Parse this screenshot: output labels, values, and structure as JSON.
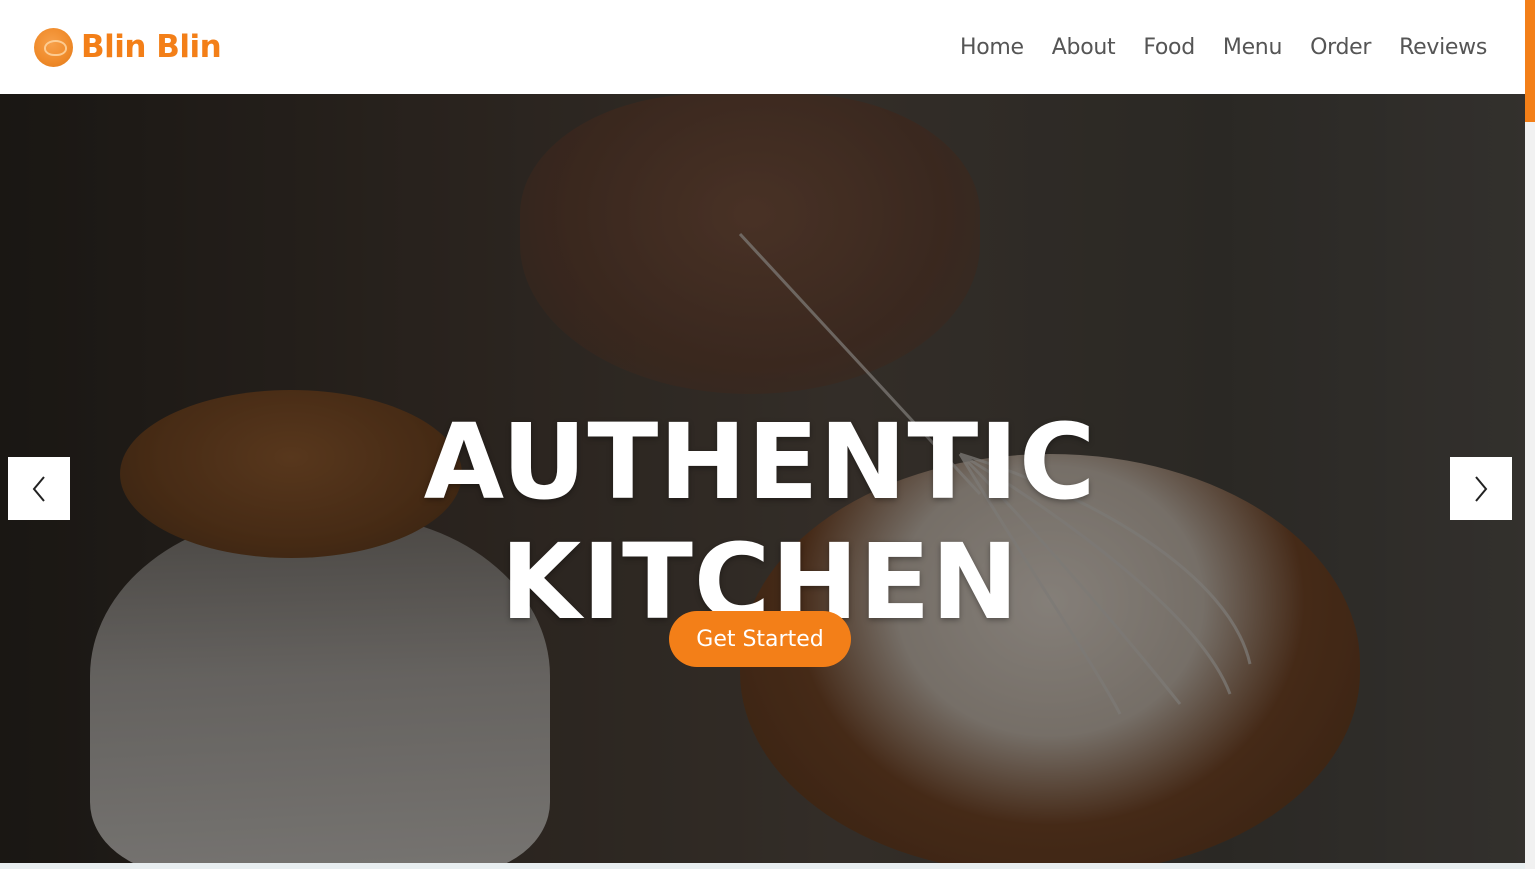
{
  "brand": {
    "name": "Blin Blin",
    "logo_icon": "brand-logo-icon"
  },
  "nav": {
    "items": [
      {
        "label": "Home"
      },
      {
        "label": "About"
      },
      {
        "label": "Food"
      },
      {
        "label": "Menu"
      },
      {
        "label": "Order"
      },
      {
        "label": "Reviews"
      }
    ]
  },
  "hero": {
    "title_line1": "AUTHENTIC",
    "title_line2": "KITCHEN",
    "cta_label": "Get Started",
    "prev_icon": "chevron-left-icon",
    "next_icon": "chevron-right-icon"
  },
  "colors": {
    "accent": "#f37f18",
    "nav_text": "#555555",
    "hero_text": "#ffffff"
  }
}
